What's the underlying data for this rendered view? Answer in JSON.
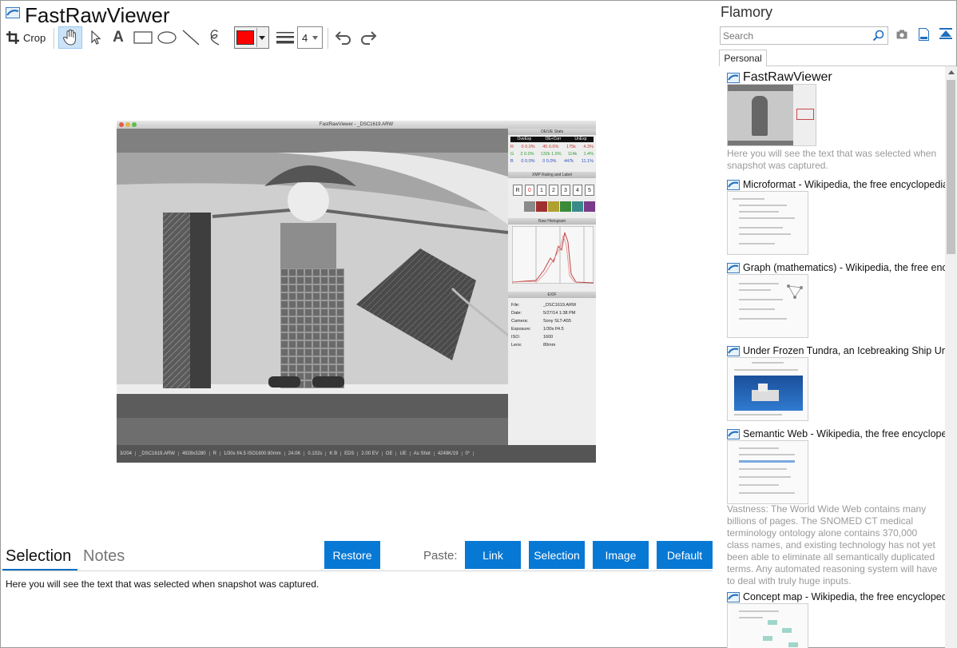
{
  "app": {
    "title": "FastRawViewer",
    "crop_label": "Crop",
    "line_width": "4",
    "stroke_color": "#ff0000"
  },
  "screenshot": {
    "window_title": "FastRawViewer - _DSC1619.ARW",
    "panel_oe_ue": "OE/UE Stats",
    "oe_cols": [
      "OveExp",
      "OE+Corr",
      "UnExp"
    ],
    "oe_rows": [
      {
        "ch": "R",
        "v1": "0 0.0%",
        "v2": "45 0.0%",
        "v3": "175k",
        "v4": "4.3%",
        "color": "#c0392b"
      },
      {
        "ch": "G",
        "v1": "2 0.0%",
        "v2": "132k 1.6%",
        "v3": "114k",
        "v4": "1.4%",
        "color": "#2e9e3a"
      },
      {
        "ch": "B",
        "v1": "0 0.0%",
        "v2": "0 0.0%",
        "v3": "447k",
        "v4": "11.1%",
        "color": "#2a4fc0"
      }
    ],
    "panel_xmp": "XMP Rating and Label",
    "ratings": [
      "R",
      "0",
      "1",
      "2",
      "3",
      "4",
      "5"
    ],
    "label_colors": [
      "#8a8a8a",
      "#a03030",
      "#b0a030",
      "#3a8a3a",
      "#3a8a8a",
      "#7a3a8a"
    ],
    "panel_hist": "Raw Histogram",
    "panel_exif": "EXIF",
    "exif": [
      {
        "k": "File:",
        "v": "_DSC1619.ARW"
      },
      {
        "k": "Date:",
        "v": "5/27/14 1:38 PM"
      },
      {
        "k": "Camera:",
        "v": "Sony SLT-A55"
      },
      {
        "k": "Exposure:",
        "v": "1/30s f/4.5"
      },
      {
        "k": "ISO:",
        "v": "1600"
      },
      {
        "k": "Lens:",
        "v": "80mm"
      }
    ],
    "status": [
      "3/204",
      "_DSC1619.ARW",
      "4928x3280",
      "R",
      "1/30s f/4.5 ISO1600 80mm",
      "24.0K",
      "0.102s",
      "K B",
      "EDS",
      "2.00 EV",
      "OE",
      "UE",
      "As Shot",
      "4249K/19",
      "0°"
    ]
  },
  "bottom": {
    "tab_selection": "Selection",
    "tab_notes": "Notes",
    "restore": "Restore",
    "paste_label": "Paste:",
    "link": "Link",
    "selection": "Selection",
    "image": "Image",
    "default": "Default",
    "selected_text": "Here you will see the text that was selected when snapshot was captured."
  },
  "flamory": {
    "title": "Flamory",
    "search_placeholder": "Search",
    "tab_personal": "Personal",
    "items": [
      {
        "title": "FastRawViewer",
        "desc": "Here you will see the text that was selected when snapshot was captured."
      },
      {
        "title": "Microformat - Wikipedia, the free encyclopedia",
        "desc": ""
      },
      {
        "title": "Graph (mathematics) - Wikipedia, the free encyc",
        "desc": ""
      },
      {
        "title": "Under Frozen Tundra, an Icebreaking Ship Unco",
        "desc": ""
      },
      {
        "title": "Semantic Web - Wikipedia, the free encycloped",
        "desc": "Vastness: The World Wide Web contains many billions of pages. The SNOMED CT medical terminology ontology alone contains 370,000 class names, and existing technology has not yet been able to eliminate all semantically duplicated terms. Any automated reasoning system will have to deal with truly huge inputs."
      },
      {
        "title": "Concept map - Wikipedia, the free encyclopedia",
        "desc": ""
      }
    ]
  }
}
